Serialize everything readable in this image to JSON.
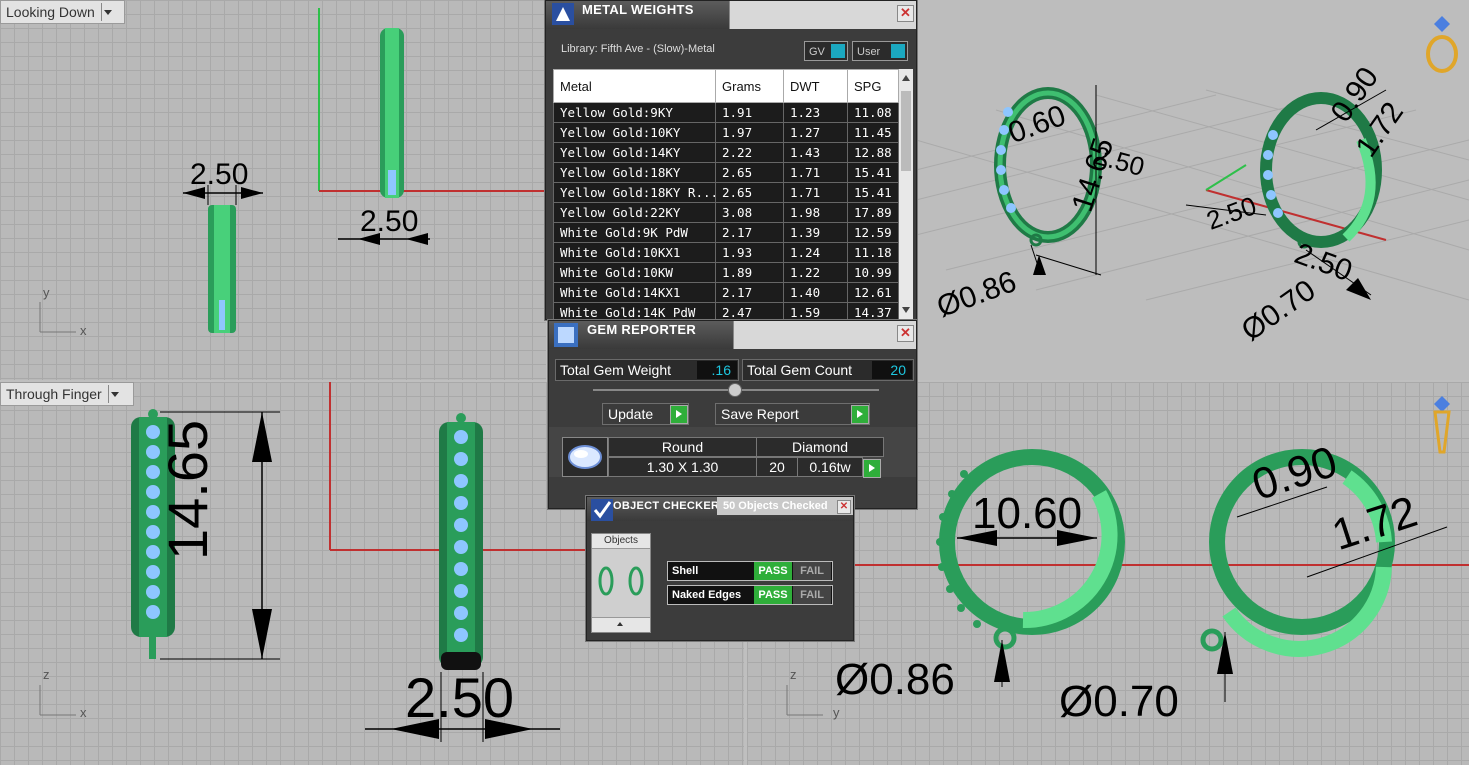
{
  "viewports": {
    "top_left": {
      "label": "Looking Down",
      "dims": {
        "a": "2.50",
        "b": "2.50"
      },
      "axes": {
        "v": "y",
        "h": "x"
      }
    },
    "bottom_left": {
      "label": "Through Finger",
      "dims": {
        "a": "14.65",
        "b": "2.50"
      },
      "axes": {
        "v": "z",
        "h": "x"
      }
    },
    "top_right": {
      "dims": {
        "a": "0.60",
        "b": "14.65",
        "c": "2.50",
        "d": "0.90",
        "e": "1.72",
        "f": "2.50",
        "g": "2.50",
        "h": "Ø0.86",
        "i": "Ø0.70"
      }
    },
    "bottom_right": {
      "dims": {
        "a": "10.60",
        "b": "0.90",
        "c": "1.72",
        "d": "Ø0.86",
        "e": "Ø0.70"
      },
      "axes": {
        "v": "z",
        "h": "y"
      }
    }
  },
  "metal_weights": {
    "title": "METAL WEIGHTS",
    "library": "Library: Fifth Ave - (Slow)-Metal",
    "gv_label": "GV",
    "user_label": "User",
    "columns": [
      "Metal",
      "Grams",
      "DWT",
      "SPG"
    ],
    "rows": [
      [
        "Yellow Gold:9KY",
        "1.91",
        "1.23",
        "11.08"
      ],
      [
        "Yellow Gold:10KY",
        "1.97",
        "1.27",
        "11.45"
      ],
      [
        "Yellow Gold:14KY",
        "2.22",
        "1.43",
        "12.88"
      ],
      [
        "Yellow Gold:18KY",
        "2.65",
        "1.71",
        "15.41"
      ],
      [
        "Yellow Gold:18KY R...",
        "2.65",
        "1.71",
        "15.41"
      ],
      [
        "Yellow Gold:22KY",
        "3.08",
        "1.98",
        "17.89"
      ],
      [
        "White Gold:9K PdW",
        "2.17",
        "1.39",
        "12.59"
      ],
      [
        "White Gold:10KX1",
        "1.93",
        "1.24",
        "11.18"
      ],
      [
        "White Gold:10KW",
        "1.89",
        "1.22",
        "10.99"
      ],
      [
        "White Gold:14KX1",
        "2.17",
        "1.40",
        "12.61"
      ],
      [
        "White Gold:14K PdW",
        "2.47",
        "1.59",
        "14.37"
      ]
    ]
  },
  "gem_reporter": {
    "title": "GEM REPORTER",
    "total_weight_label": "Total Gem Weight",
    "total_weight_value": ".16",
    "total_count_label": "Total Gem Count",
    "total_count_value": "20",
    "update_label": "Update",
    "save_label": "Save Report",
    "shape": "Round",
    "material": "Diamond",
    "size": "1.30 X 1.30",
    "count": "20",
    "weight": "0.16tw"
  },
  "object_checker": {
    "title": "OBJECT CHECKER",
    "status": "50  Objects Checked",
    "objects_label": "Objects",
    "checks": [
      {
        "name": "Shell",
        "pass": "PASS",
        "fail": "FAIL"
      },
      {
        "name": "Naked Edges",
        "pass": "PASS",
        "fail": "FAIL"
      }
    ]
  },
  "colors": {
    "accent_green": "#2fae3a",
    "value_cyan": "#1ec7e0",
    "model_green": "#2a9d5a"
  }
}
